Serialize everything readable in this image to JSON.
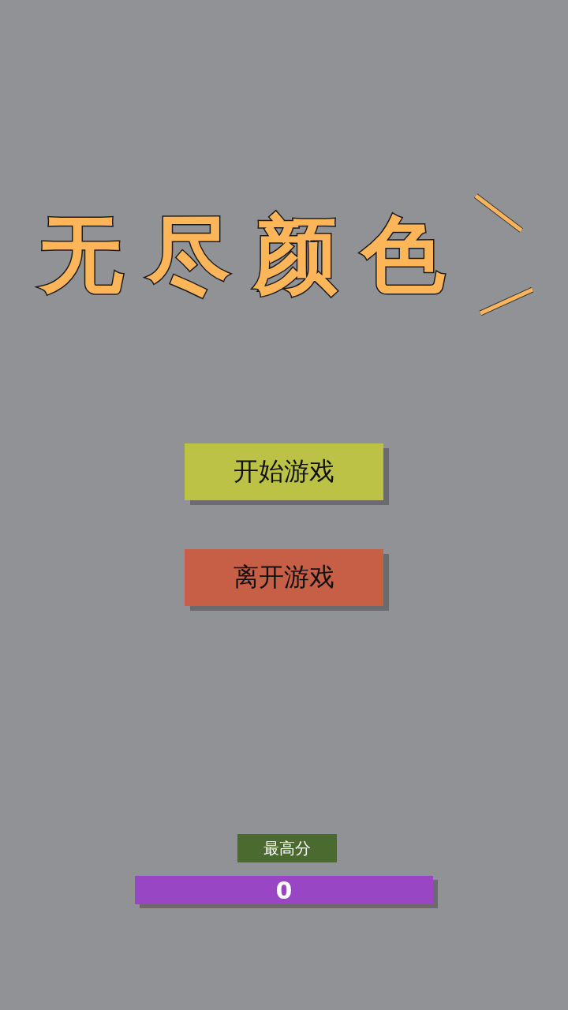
{
  "title": {
    "text": "无尽颜色"
  },
  "buttons": [
    {
      "label": "开始游戏",
      "color": "#bcc246"
    },
    {
      "label": "离开游戏",
      "color": "#c65f45"
    }
  ],
  "high_score": {
    "label": "最高分",
    "value": "0"
  }
}
